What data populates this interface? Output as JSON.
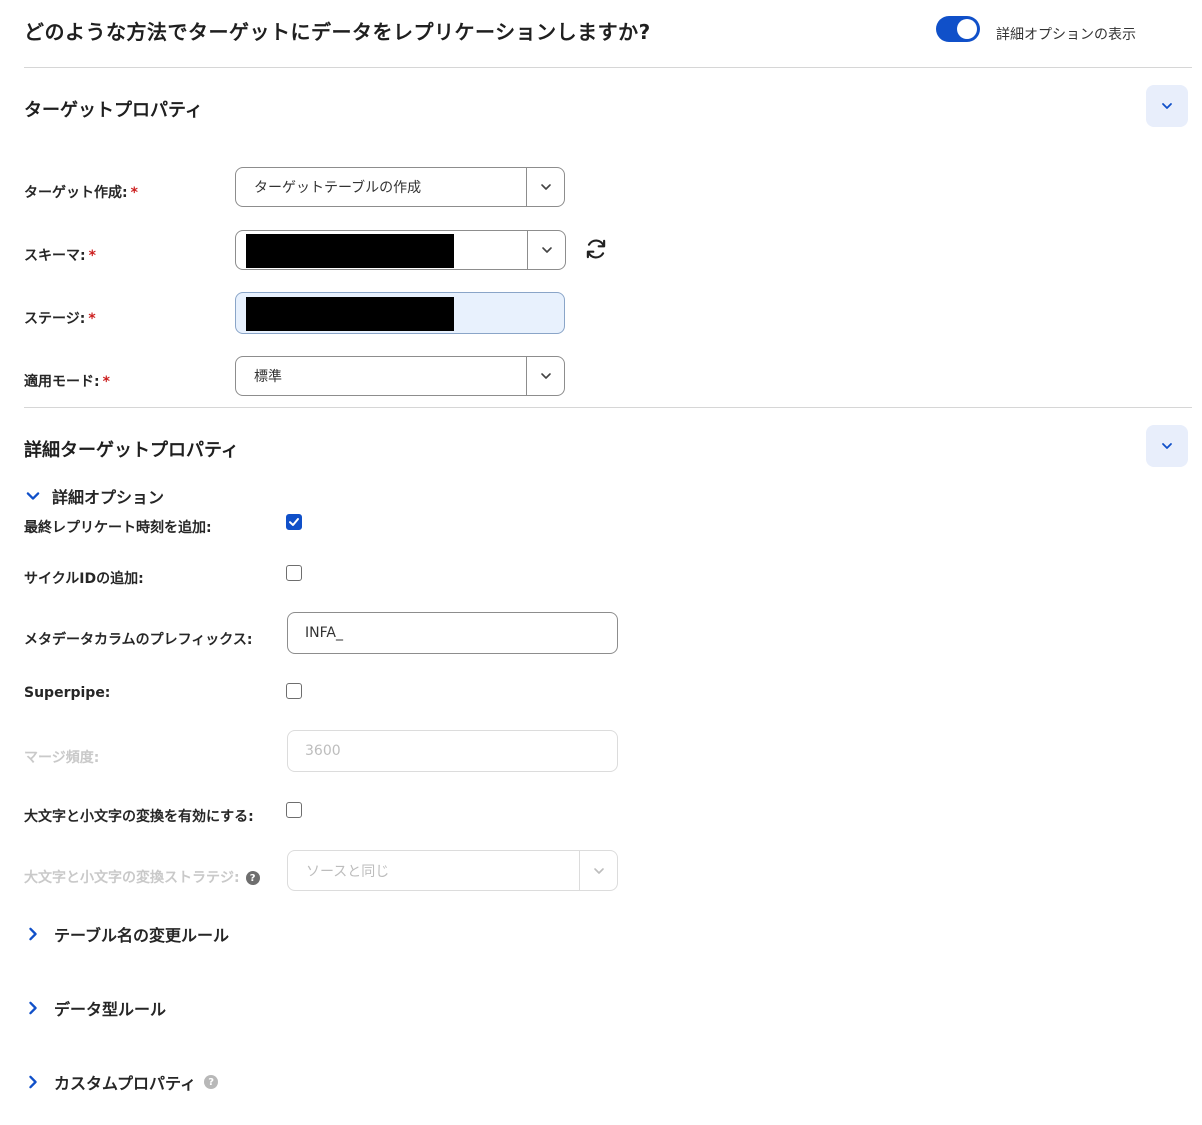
{
  "header": {
    "title": "どのような方法でターゲットにデータをレプリケーションしますか?",
    "advanced_toggle_label": "詳細オプションの表示",
    "advanced_toggle_on": true
  },
  "colors": {
    "accent": "#1050c9",
    "required": "#cc1e1e",
    "collapse_bg": "#e8eefb",
    "stage_bg": "#e8f1fd"
  },
  "target_properties": {
    "title": "ターゲットプロパティ",
    "fields": {
      "target_create": {
        "label": "ターゲット作成:",
        "value": "ターゲットテーブルの作成"
      },
      "schema": {
        "label": "スキーマ:"
      },
      "stage": {
        "label": "ステージ:"
      },
      "apply_mode": {
        "label": "適用モード:",
        "value": "標準"
      }
    },
    "required_mark": "*"
  },
  "advanced_target_properties": {
    "title": "詳細ターゲットプロパティ",
    "advanced_options": {
      "label": "詳細オプション",
      "expanded": true,
      "fields": {
        "add_last_replicated_time": {
          "label": "最終レプリケート時刻を追加:",
          "checked": true
        },
        "add_cycle_id": {
          "label": "サイクルIDの追加:",
          "checked": false
        },
        "metadata_column_prefix": {
          "label": "メタデータカラムのプレフィックス:",
          "value": "INFA_"
        },
        "superpipe": {
          "label": "Superpipe:",
          "checked": false
        },
        "merge_frequency": {
          "label": "マージ頻度:",
          "value": "3600",
          "disabled": true
        },
        "enable_case_conversion": {
          "label": "大文字と小文字の変換を有効にする:",
          "checked": false
        },
        "case_conversion_strategy": {
          "label": "大文字と小文字の変換ストラテジ:",
          "value": "ソースと同じ",
          "disabled": true
        }
      }
    },
    "collapsed_sections": {
      "table_rename_rules": "テーブル名の変更ルール",
      "data_type_rules": "データ型ルール",
      "custom_properties": "カスタムプロパティ"
    }
  },
  "icons": {
    "collapse": "chevron-down-icon",
    "expand": "chevron-right-icon",
    "refresh": "refresh-icon",
    "help": "question-circle-icon",
    "check": "checkmark-icon"
  }
}
